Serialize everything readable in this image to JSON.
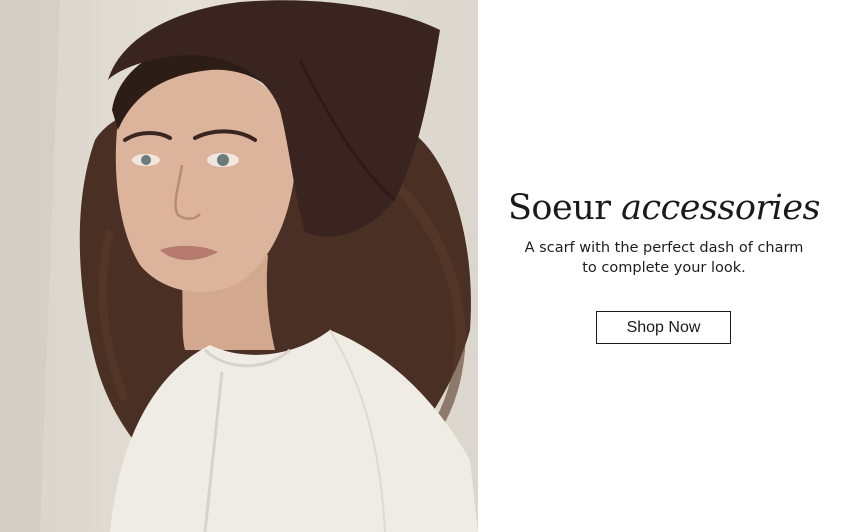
{
  "hero": {
    "image_alt": "Model wearing a dark brown headscarf and white shirt",
    "headline_regular": "Soeur",
    "headline_italic": "accessories",
    "subtext_line1": "A scarf with the perfect dash of charm",
    "subtext_line2": "to complete your look.",
    "cta_label": "Shop Now"
  },
  "colors": {
    "background": "#ffffff",
    "text": "#1a1a1a",
    "scarf": "#3a2420",
    "hair": "#4a3024",
    "shirt": "#efece6"
  }
}
